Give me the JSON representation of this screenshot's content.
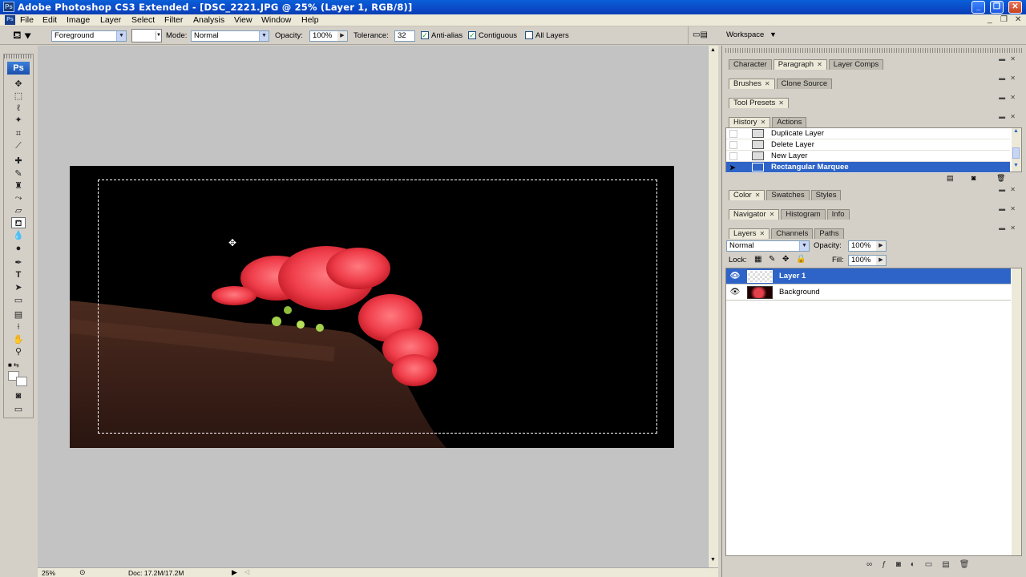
{
  "window": {
    "title": "Adobe Photoshop CS3 Extended - [DSC_2221.JPG @ 25% (Layer 1, RGB/8)]",
    "app_icon": "Ps"
  },
  "menu": [
    "File",
    "Edit",
    "Image",
    "Layer",
    "Select",
    "Filter",
    "Analysis",
    "View",
    "Window",
    "Help"
  ],
  "options": {
    "fill_source": "Foreground",
    "mode_label": "Mode:",
    "mode_value": "Normal",
    "opacity_label": "Opacity:",
    "opacity_value": "100%",
    "tolerance_label": "Tolerance:",
    "tolerance_value": "32",
    "antialias_label": "Anti-alias",
    "antialias_checked": true,
    "contiguous_label": "Contiguous",
    "contiguous_checked": true,
    "alllayers_label": "All Layers",
    "alllayers_checked": false,
    "workspace_label": "Workspace"
  },
  "toolbox": {
    "logo": "Ps"
  },
  "status": {
    "zoom": "25%",
    "doc": "Doc: 17.2M/17.2M"
  },
  "panels": {
    "g1": [
      "Character",
      "Paragraph",
      "Layer Comps"
    ],
    "g2": [
      "Brushes",
      "Clone Source"
    ],
    "g3": [
      "Tool Presets"
    ],
    "g4": [
      "History",
      "Actions"
    ],
    "history": [
      "Duplicate Layer",
      "Delete Layer",
      "New Layer",
      "Rectangular Marquee"
    ],
    "g5": [
      "Color",
      "Swatches",
      "Styles"
    ],
    "g6": [
      "Navigator",
      "Histogram",
      "Info"
    ],
    "g7": [
      "Layers",
      "Channels",
      "Paths"
    ],
    "layers": {
      "blend": "Normal",
      "opacity_label": "Opacity:",
      "opacity": "100%",
      "lock_label": "Lock:",
      "fill_label": "Fill:",
      "fill": "100%",
      "items": [
        "Layer 1",
        "Background"
      ]
    }
  },
  "colors": {
    "selection": "#2e64c8",
    "titlebar": "#0b49c7",
    "flower": "#f24a55"
  }
}
